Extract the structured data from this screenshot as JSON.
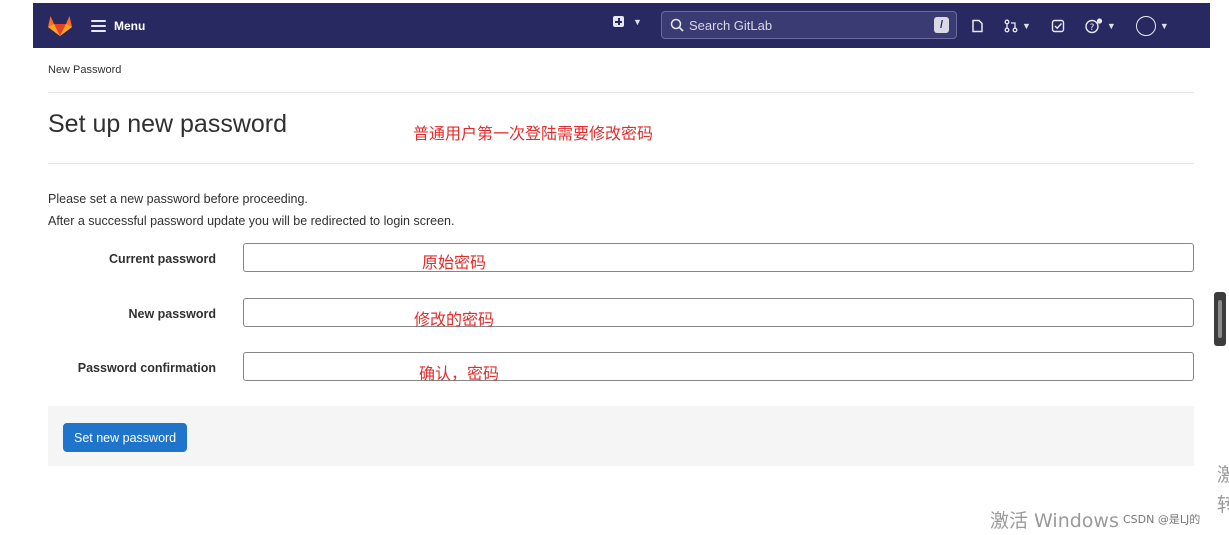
{
  "navbar": {
    "menu_label": "Menu",
    "search_placeholder": "Search GitLab",
    "search_shortcut": "/",
    "colors": {
      "background": "#292961",
      "logo": "#fc6d26"
    }
  },
  "breadcrumb": "New Password",
  "page": {
    "title": "Set up new password",
    "info_lines": [
      "Please set a new password before proceeding.",
      "After a successful password update you will be redirected to login screen."
    ]
  },
  "annotations": {
    "title_note": "普通用户第一次登陆需要修改密码",
    "current_note": "原始密码",
    "new_note": "修改的密码",
    "confirm_note": "确认，密码"
  },
  "form": {
    "fields": [
      {
        "label": "Current password",
        "value": ""
      },
      {
        "label": "New password",
        "value": ""
      },
      {
        "label": "Password confirmation",
        "value": ""
      }
    ],
    "submit_label": "Set new password",
    "colors": {
      "primary": "#1f75cb"
    }
  },
  "overlay": {
    "windows_watermark": "激活 Windows",
    "csdn": "CSDN @是LJ的",
    "edge_chars": [
      "激",
      "转"
    ]
  }
}
